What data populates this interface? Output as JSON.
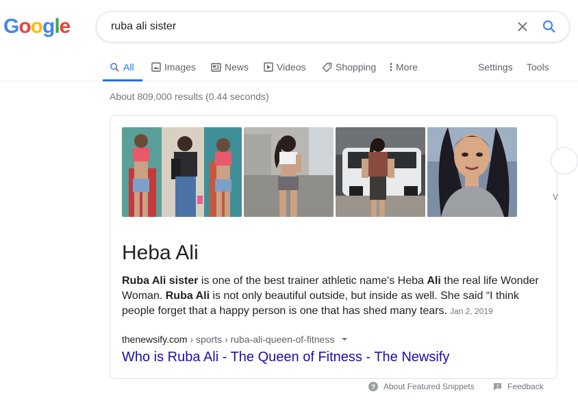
{
  "logo": {
    "letters": [
      {
        "char": "G",
        "color": "#4285F4"
      },
      {
        "char": "o",
        "color": "#EA4335"
      },
      {
        "char": "o",
        "color": "#FBBC05"
      },
      {
        "char": "g",
        "color": "#4285F4"
      },
      {
        "char": "l",
        "color": "#34A853"
      },
      {
        "char": "e",
        "color": "#EA4335"
      }
    ]
  },
  "search": {
    "query": "ruba ali sister"
  },
  "tabs": {
    "all": "All",
    "images": "Images",
    "news": "News",
    "videos": "Videos",
    "shopping": "Shopping",
    "more": "More",
    "settings": "Settings",
    "tools": "Tools"
  },
  "result_stats": "About 809,000 results (0.44 seconds)",
  "featured_snippet": {
    "images": [
      "fitness-collage",
      "gym-workout",
      "car-parking",
      "selfie"
    ],
    "title": "Heba Ali",
    "text": {
      "b1": "Ruba Ali sister",
      "t1": " is one of the best trainer athletic name's Heba ",
      "b2": "Ali",
      "t2": " the real life Wonder Woman. ",
      "b3": "Ruba Ali",
      "t3": " is not only beautiful outside, but inside as well. She said “I think people forget that a happy person is one that has shed many tears.",
      "date": "Jan 2, 2019"
    },
    "edge_char": "V",
    "breadcrumb": {
      "site": "thenewsify.com",
      "path": "› sports › ruba-ali-queen-of-fitness"
    },
    "link_title": "Who is Ruba Ali - The Queen of Fitness - The Newsify"
  },
  "footer": {
    "about": "About Featured Snippets",
    "feedback": "Feedback"
  },
  "colors": {
    "accent": "#1a73e8",
    "link": "#1a0dab"
  }
}
